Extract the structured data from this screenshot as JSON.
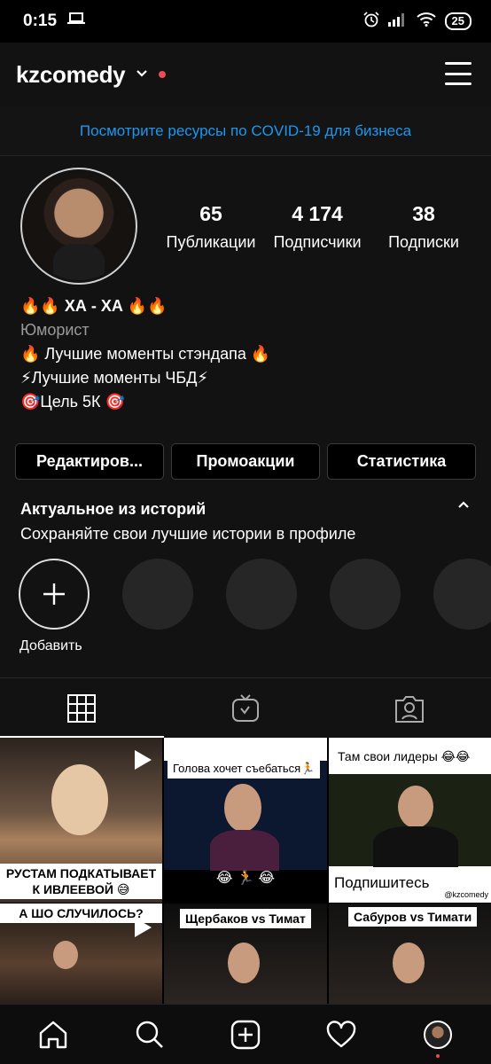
{
  "status_bar": {
    "time": "0:15",
    "battery": "25"
  },
  "header": {
    "username": "kzcomedy",
    "chevron": "⌄"
  },
  "covid_banner": "Посмотрите ресурсы по COVID-19 для бизнеса",
  "stats": [
    {
      "value": "65",
      "label": "Публикации"
    },
    {
      "value": "4 174",
      "label": "Подписчики"
    },
    {
      "value": "38",
      "label": "Подписки"
    }
  ],
  "bio": {
    "name": "🔥🔥 ХА - ХА 🔥🔥",
    "category": "Юморист",
    "lines": [
      "🔥 Лучшие моменты стэндапа 🔥",
      "⚡Лучшие моменты ЧБД⚡",
      "🎯Цель 5К 🎯"
    ]
  },
  "buttons": {
    "edit": "Редактиров...",
    "promo": "Промоакции",
    "stats": "Статистика"
  },
  "highlights": {
    "title": "Актуальное из историй",
    "subtitle": "Сохраняйте свои лучшие истории в профиле",
    "add_label": "Добавить"
  },
  "posts": [
    {
      "caption": "РУСТАМ ПОДКАТЫВАЕТ К ИВЛЕЕВОЙ 😅"
    },
    {
      "caption": "Голова хочет съебаться🏃",
      "bottom": "😂 🏃 😂"
    },
    {
      "caption": "Там свои лидеры 😂😂",
      "bottom": "Подпишитесь",
      "handle": "@kzcomedy"
    },
    {
      "caption": "А ШО СЛУЧИЛОСЬ?"
    },
    {
      "caption": "Щербаков vs Тимат"
    },
    {
      "caption": "Сабуров vs Тимати"
    }
  ],
  "icons": {
    "status": [
      "laptop-icon",
      "alarm-icon",
      "signal-icon",
      "wifi-icon",
      "battery-icon"
    ],
    "tabs": [
      "grid-icon",
      "igtv-icon",
      "tagged-icon"
    ],
    "nav": [
      "home-icon",
      "search-icon",
      "new-post-icon",
      "activity-icon",
      "profile-icon"
    ]
  },
  "colors": {
    "link": "#1d97ef",
    "notification": "#ed4956",
    "background": "#121212"
  }
}
